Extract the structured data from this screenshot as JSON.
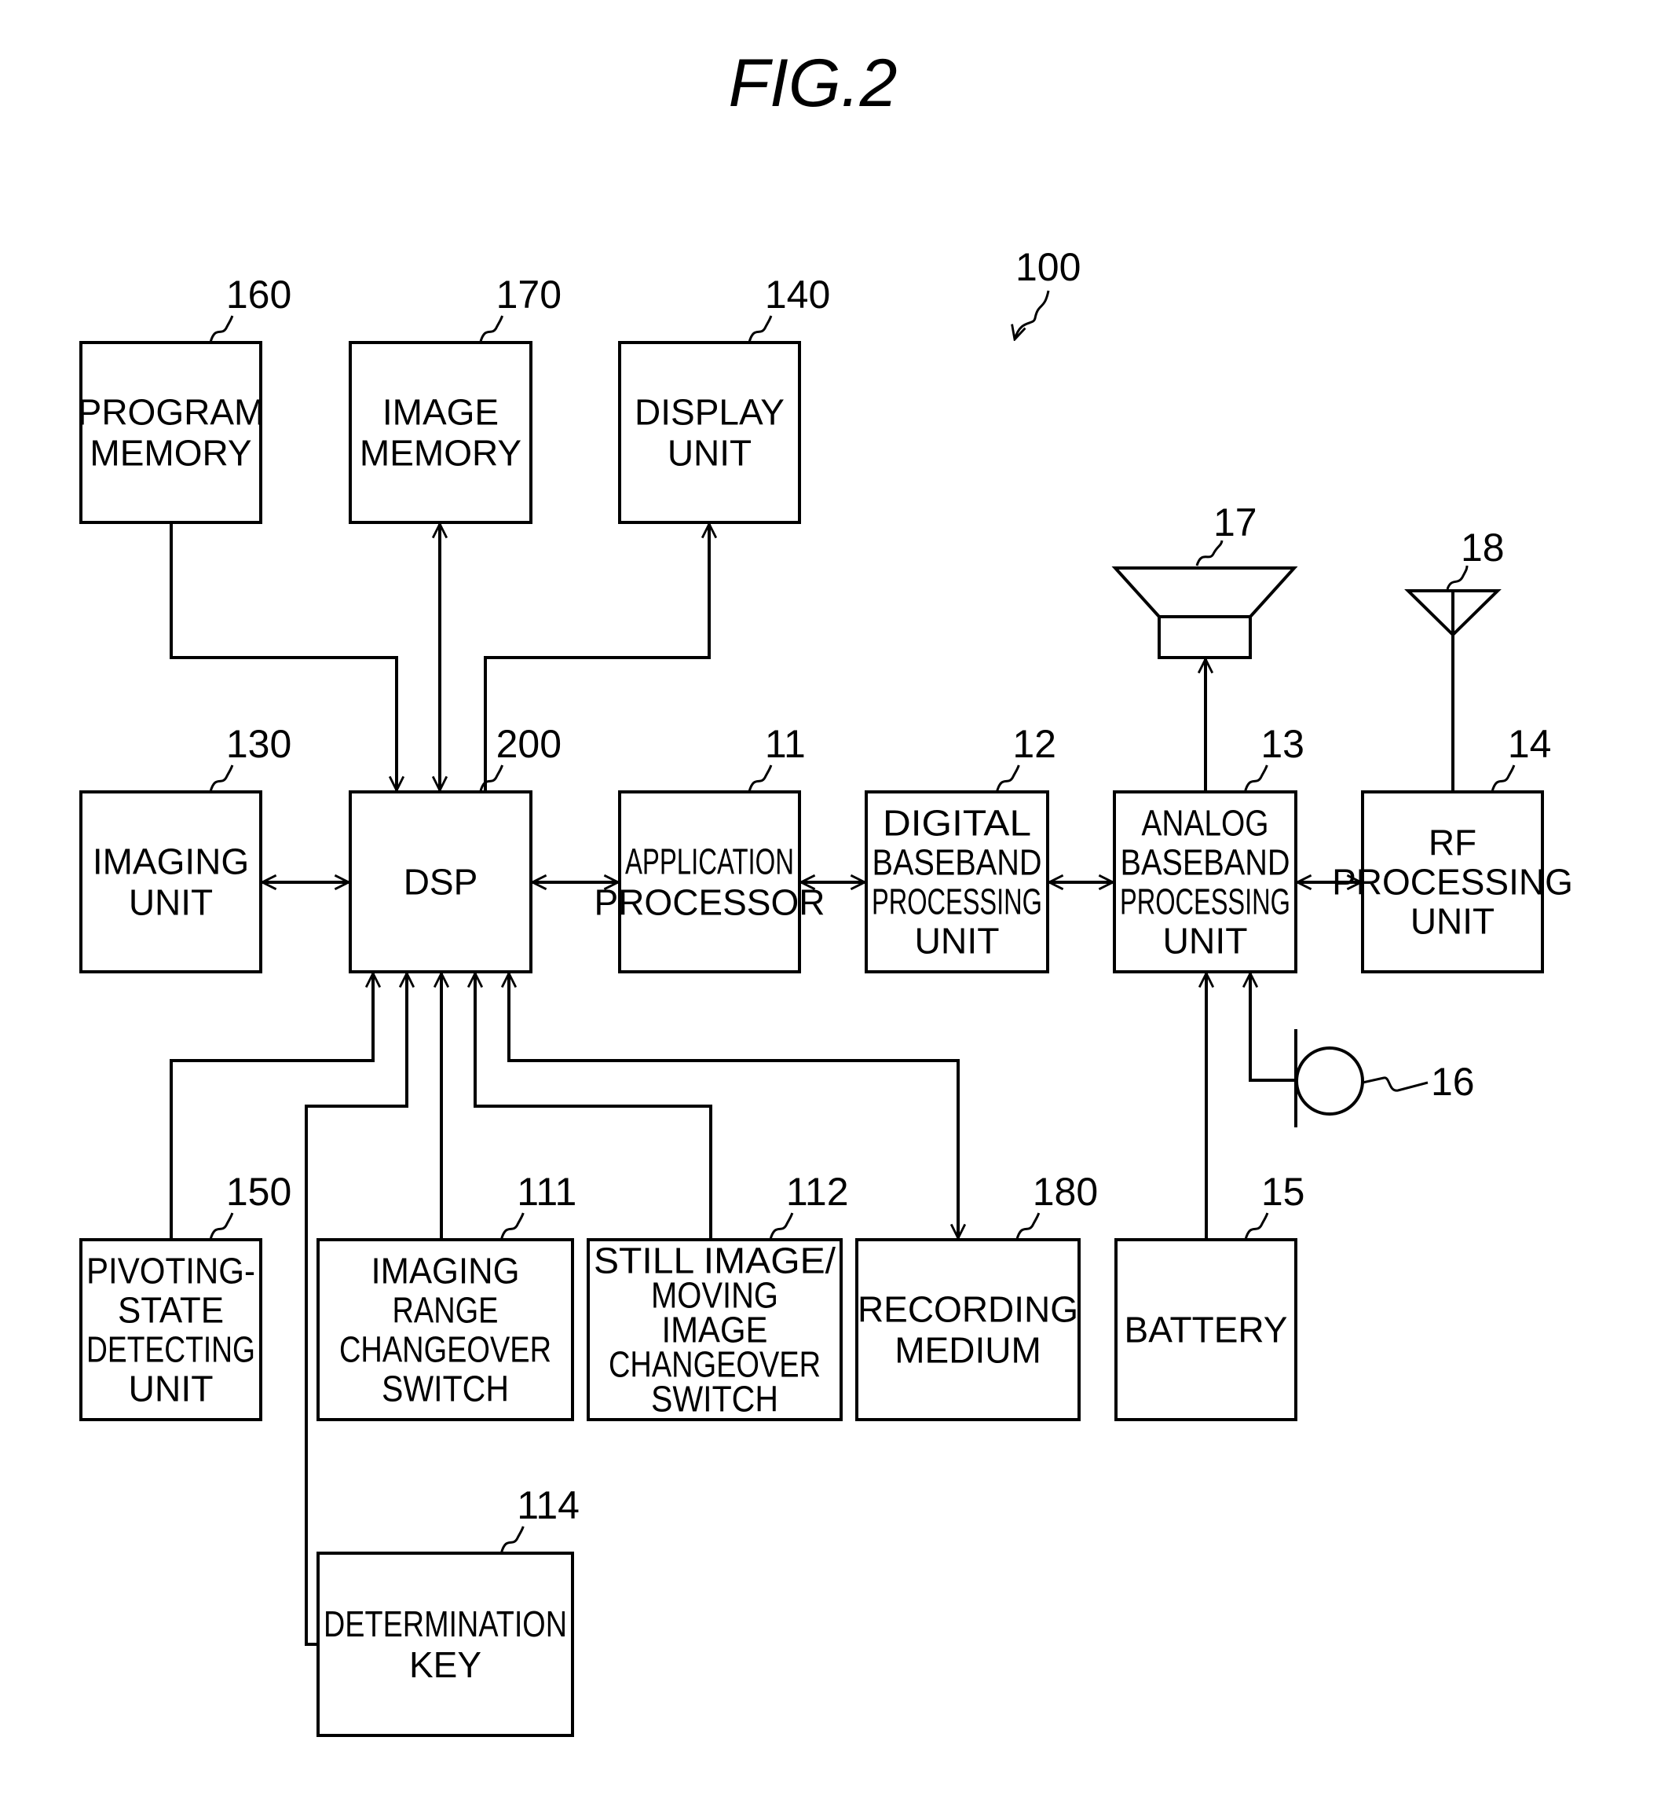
{
  "figure": {
    "title": "FIG.2",
    "device_ref": "100"
  },
  "blocks": {
    "program_memory": {
      "ref": "160",
      "lines": [
        "PROGRAM",
        "MEMORY"
      ]
    },
    "image_memory": {
      "ref": "170",
      "lines": [
        "IMAGE",
        "MEMORY"
      ]
    },
    "display_unit": {
      "ref": "140",
      "lines": [
        "DISPLAY",
        "UNIT"
      ]
    },
    "imaging_unit": {
      "ref": "130",
      "lines": [
        "IMAGING",
        "UNIT"
      ]
    },
    "dsp": {
      "ref": "200",
      "lines": [
        "DSP"
      ]
    },
    "application_processor": {
      "ref": "11",
      "lines": [
        "APPLICATION",
        "PROCESSOR"
      ]
    },
    "digital_baseband": {
      "ref": "12",
      "lines": [
        "DIGITAL",
        "BASEBAND",
        "PROCESSING",
        "UNIT"
      ]
    },
    "analog_baseband": {
      "ref": "13",
      "lines": [
        "ANALOG",
        "BASEBAND",
        "PROCESSING",
        "UNIT"
      ]
    },
    "rf_processing": {
      "ref": "14",
      "lines": [
        "RF",
        "PROCESSING",
        "UNIT"
      ]
    },
    "pivoting_state": {
      "ref": "150",
      "lines": [
        "PIVOTING-",
        "STATE",
        "DETECTING",
        "UNIT"
      ]
    },
    "imaging_range_switch": {
      "ref": "111",
      "lines": [
        "IMAGING",
        "RANGE",
        "CHANGEOVER",
        "SWITCH"
      ]
    },
    "still_moving_switch": {
      "ref": "112",
      "lines": [
        "STILL IMAGE/",
        "MOVING",
        "IMAGE",
        "CHANGEOVER",
        "SWITCH"
      ]
    },
    "recording_medium": {
      "ref": "180",
      "lines": [
        "RECORDING",
        "MEDIUM"
      ]
    },
    "battery": {
      "ref": "15",
      "lines": [
        "BATTERY"
      ]
    },
    "determination_key": {
      "ref": "114",
      "lines": [
        "DETERMINATION",
        "KEY"
      ]
    }
  },
  "symbols": {
    "speaker": {
      "ref": "17"
    },
    "antenna": {
      "ref": "18"
    },
    "microphone": {
      "ref": "16"
    }
  }
}
